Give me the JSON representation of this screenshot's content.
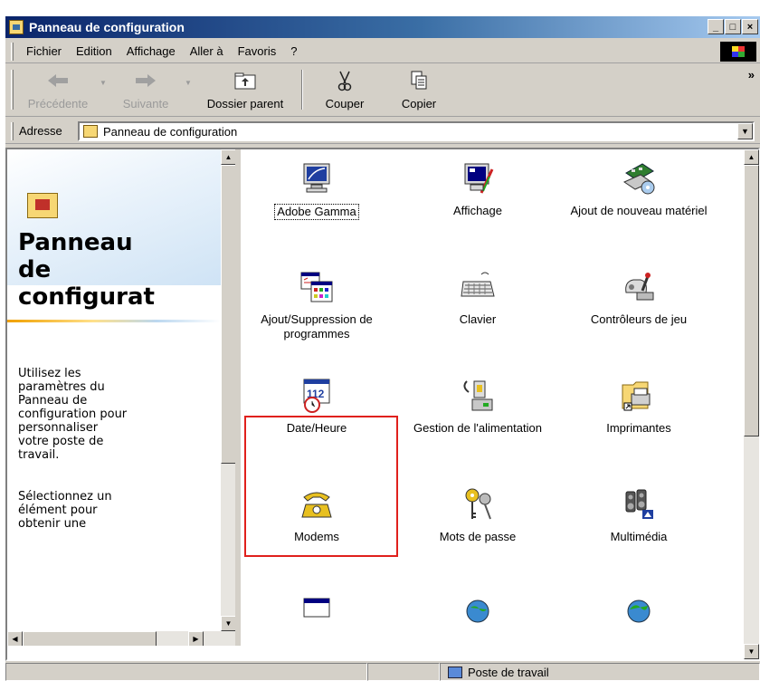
{
  "window": {
    "title": "Panneau de configuration",
    "controls": [
      "_",
      "□",
      "×"
    ]
  },
  "menu": {
    "items": [
      "Fichier",
      "Edition",
      "Affichage",
      "Aller à",
      "Favoris",
      "?"
    ]
  },
  "toolbar": {
    "back": "Précédente",
    "forward": "Suivante",
    "up": "Dossier parent",
    "cut": "Couper",
    "copy": "Copier",
    "more": "»"
  },
  "address": {
    "label": "Adresse",
    "value": "Panneau de configuration"
  },
  "left_pane": {
    "title_lines": [
      "Panneau",
      "de",
      "configurat"
    ],
    "description": "Utilisez les\nparamètres du\nPanneau de\nconfiguration pour\npersonnaliser\nvotre poste de\ntravail.",
    "hint": "Sélectionnez un\nélément pour\nobtenir une"
  },
  "items": [
    {
      "label": "Adobe Gamma",
      "icon": "monitor-icon"
    },
    {
      "label": "Affichage",
      "icon": "display-icon"
    },
    {
      "label": "Ajout de nouveau matériel",
      "icon": "hardware-icon"
    },
    {
      "label": "Ajout/Suppression de programmes",
      "icon": "programs-icon"
    },
    {
      "label": "Clavier",
      "icon": "keyboard-icon"
    },
    {
      "label": "Contrôleurs de jeu",
      "icon": "joystick-icon"
    },
    {
      "label": "Date/Heure",
      "icon": "calendar-icon"
    },
    {
      "label": "Gestion de l'alimentation",
      "icon": "power-icon"
    },
    {
      "label": "Imprimantes",
      "icon": "printer-icon"
    },
    {
      "label": "Modems",
      "icon": "phone-icon"
    },
    {
      "label": "Mots de passe",
      "icon": "keys-icon"
    },
    {
      "label": "Multimédia",
      "icon": "multimedia-icon"
    }
  ],
  "status": {
    "location": "Poste de travail"
  },
  "colors": {
    "titlebar_start": "#0a246a",
    "titlebar_end": "#a6caf0",
    "chrome": "#d4d0c8",
    "highlight_border": "#e0201c"
  }
}
